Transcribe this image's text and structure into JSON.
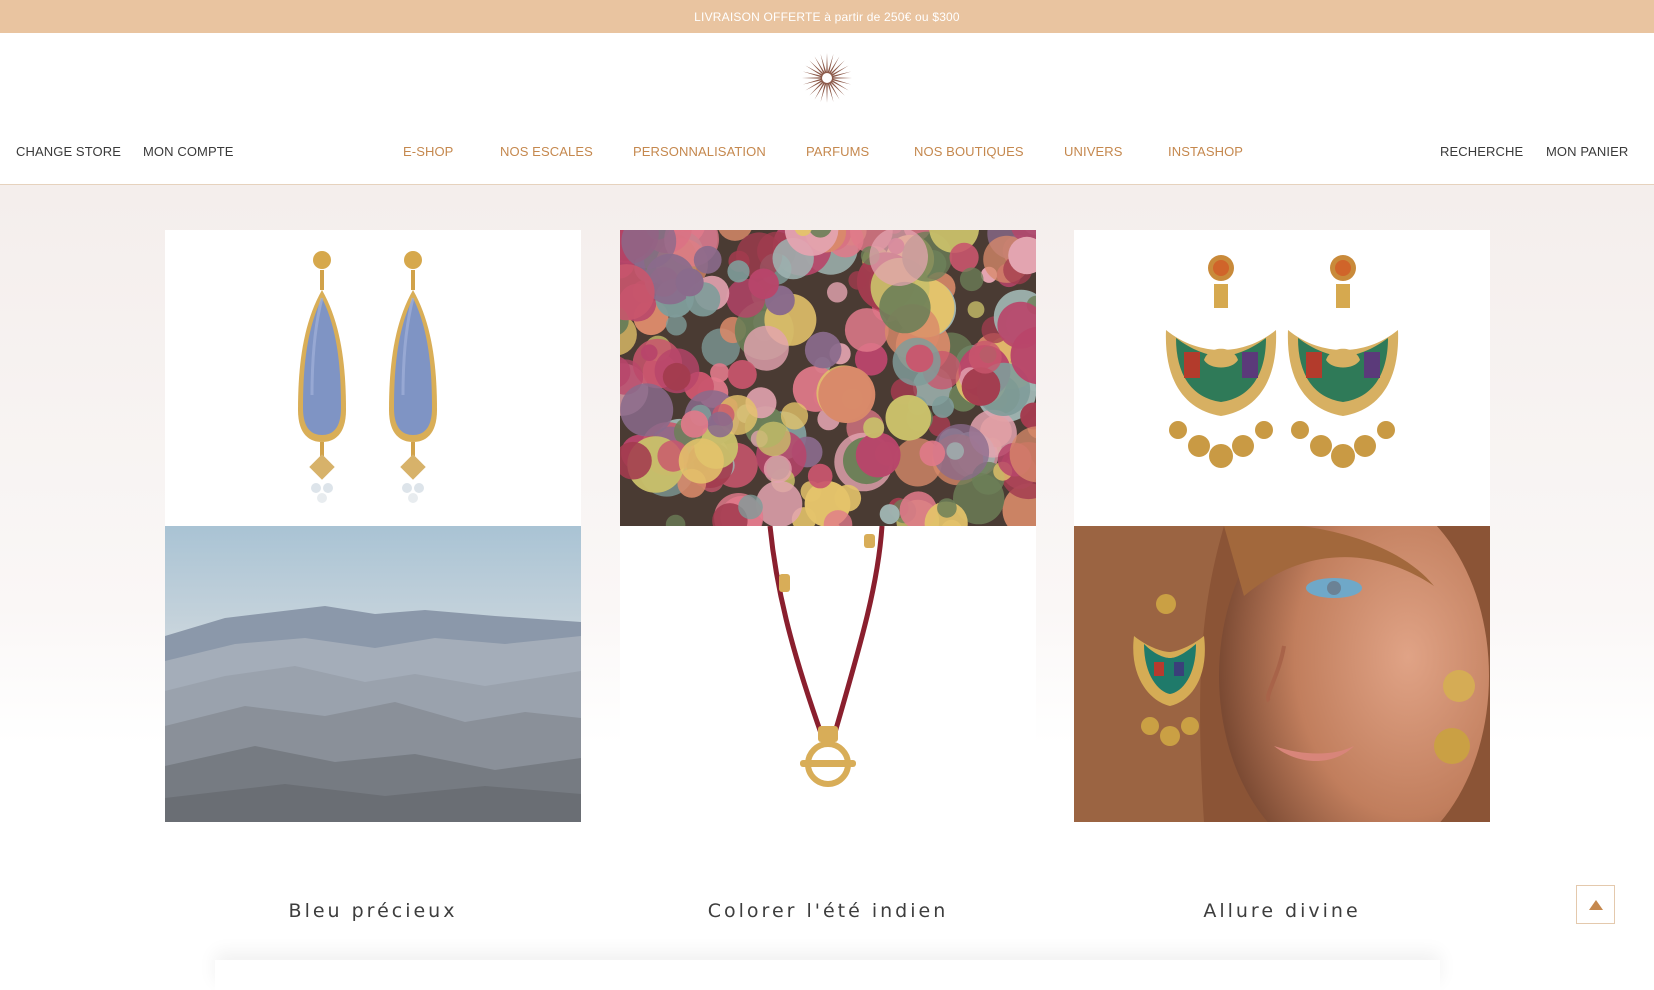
{
  "promo": {
    "text": "LIVRAISON OFFERTE à partir de 250€ ou $300"
  },
  "header": {
    "logo": "sun-star-logo",
    "left_links": [
      "CHANGE STORE",
      "MON COMPTE"
    ],
    "main_nav": [
      "E-SHOP",
      "NOS ESCALES",
      "PERSONNALISATION",
      "PARFUMS",
      "NOS BOUTIQUES",
      "UNIVERS",
      "INSTASHOP"
    ],
    "right_links": [
      "RECHERCHE",
      "MON PANIER"
    ]
  },
  "collections": [
    {
      "title": "Bleu précieux",
      "product": "blue-drop-earrings",
      "mood": "misty-mountains"
    },
    {
      "title": "Colorer l'été indien",
      "product": "red-cord-necklace",
      "mood": "autumn-forest"
    },
    {
      "title": "Allure divine",
      "product": "enamel-chandelier-earrings",
      "mood": "model-wearing-earrings"
    }
  ],
  "scroll_top": {
    "icon": "arrow-up-icon"
  },
  "colors": {
    "accent": "#c5884e",
    "promo_bg": "#e9c4a0",
    "text_dark": "#3a3a3a"
  }
}
